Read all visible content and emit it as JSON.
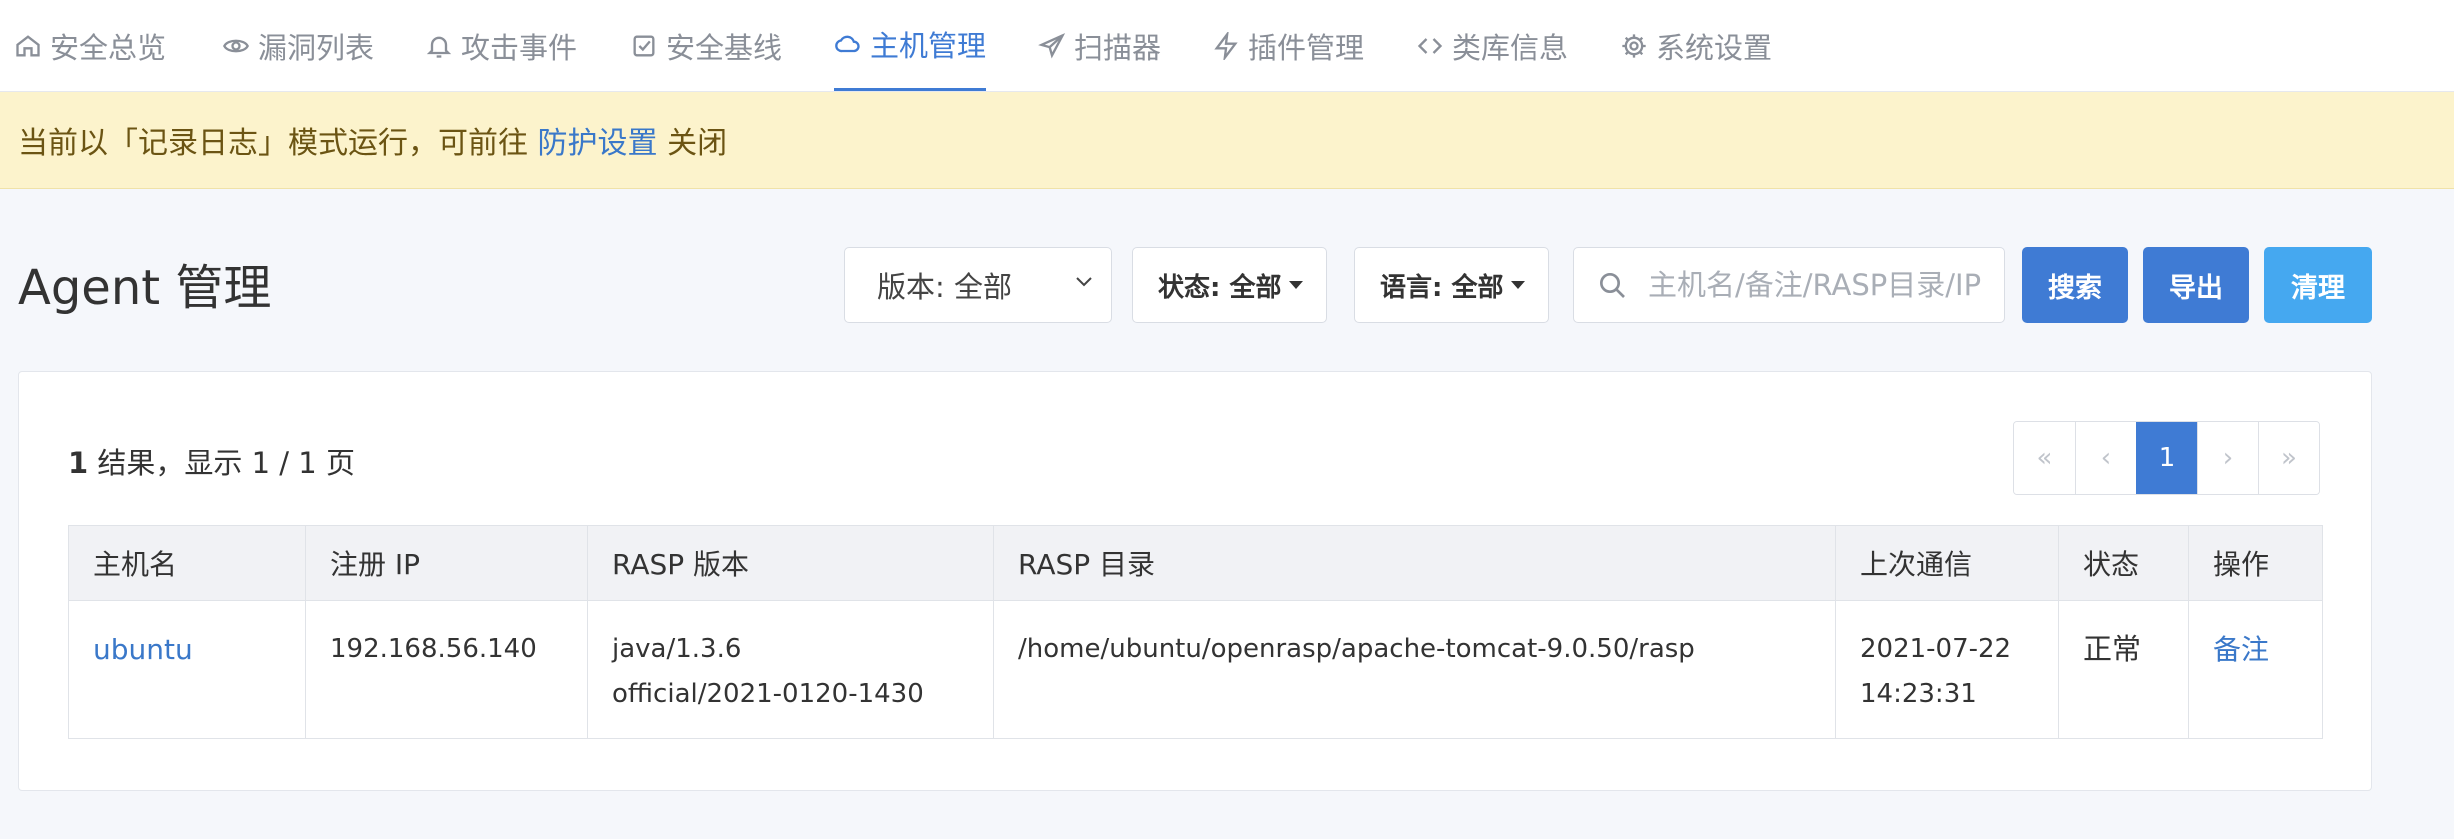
{
  "nav": {
    "items": [
      {
        "label": "安全总览",
        "icon": "home-icon"
      },
      {
        "label": "漏洞列表",
        "icon": "eye-icon"
      },
      {
        "label": "攻击事件",
        "icon": "bell-icon"
      },
      {
        "label": "安全基线",
        "icon": "checkbox-icon"
      },
      {
        "label": "主机管理",
        "icon": "cloud-icon",
        "active": true
      },
      {
        "label": "扫描器",
        "icon": "send-icon"
      },
      {
        "label": "插件管理",
        "icon": "bolt-icon"
      },
      {
        "label": "类库信息",
        "icon": "code-icon"
      },
      {
        "label": "系统设置",
        "icon": "gear-icon"
      }
    ]
  },
  "banner": {
    "prefix": "当前以「记录日志」模式运行，可前往",
    "link": "防护设置",
    "suffix": "关闭"
  },
  "page": {
    "title": "Agent 管理"
  },
  "filters": {
    "version": "版本: 全部",
    "status": "状态: 全部",
    "language": "语言: 全部",
    "search_placeholder": "主机名/备注/RASP目录/IP",
    "search_value": ""
  },
  "buttons": {
    "search": "搜索",
    "export": "导出",
    "clean": "清理"
  },
  "results": {
    "count": "1",
    "summary": "结果，显示 1 / 1 页"
  },
  "pagination": {
    "first": "«",
    "prev": "‹",
    "current": "1",
    "next": "›",
    "last": "»"
  },
  "table": {
    "headers": [
      "主机名",
      "注册 IP",
      "RASP 版本",
      "RASP 目录",
      "上次通信",
      "状态",
      "操作"
    ],
    "rows": [
      {
        "hostname": "ubuntu",
        "ip": "192.168.56.140",
        "version_line1": "java/1.3.6",
        "version_line2": "official/2021-0120-1430",
        "dir": "/home/ubuntu/openrasp/apache-tomcat-9.0.50/rasp",
        "last_date": "2021-07-22",
        "last_time": "14:23:31",
        "status": "正常",
        "action": "备注"
      }
    ]
  },
  "colors": {
    "accent": "#3f7bd4",
    "banner_bg": "#fcf3cc",
    "clean_button": "#45a8f0"
  }
}
